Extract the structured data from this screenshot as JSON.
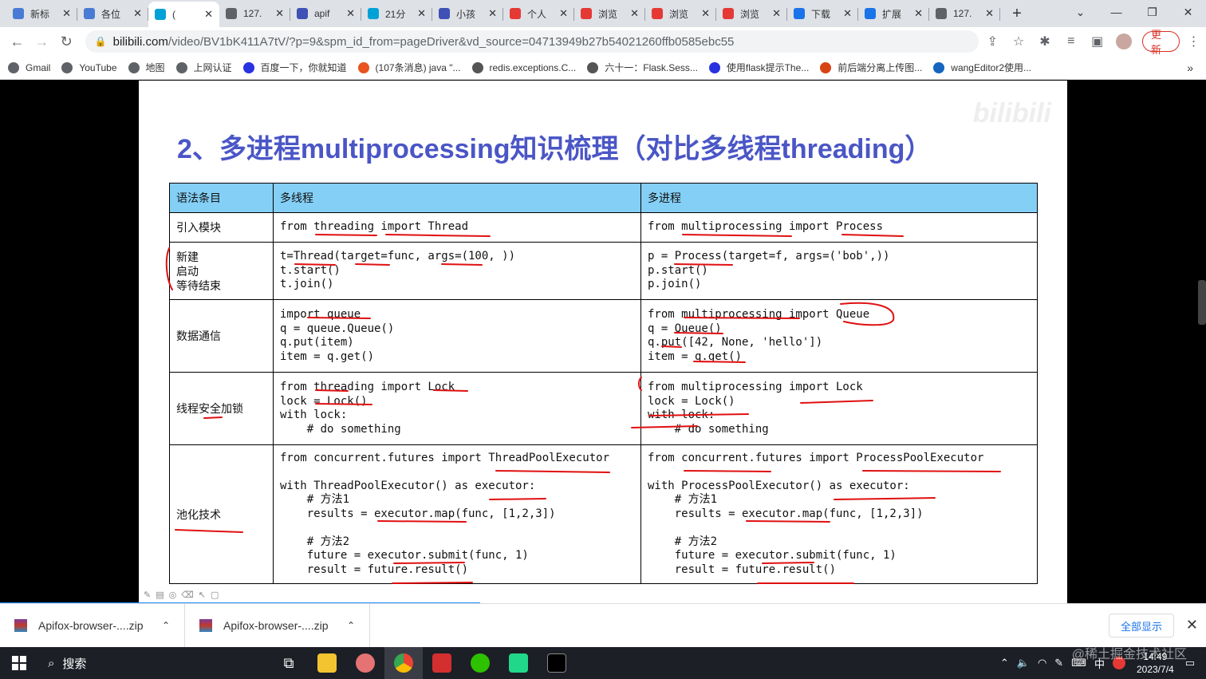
{
  "browser": {
    "tabs": [
      {
        "title": "新标",
        "color": "#4a7bd4",
        "active": false
      },
      {
        "title": "各位",
        "color": "#4a7bd4",
        "active": false
      },
      {
        "title": "(",
        "color": "#00a1d6",
        "active": true
      },
      {
        "title": "127.",
        "color": "#5f6368",
        "active": false
      },
      {
        "title": "apif",
        "color": "#3f51b5",
        "active": false
      },
      {
        "title": "21分",
        "color": "#00a1d6",
        "active": false
      },
      {
        "title": "小孩",
        "color": "#3f51b5",
        "active": false
      },
      {
        "title": "个人",
        "color": "#e53935",
        "active": false
      },
      {
        "title": "浏览",
        "color": "#e53935",
        "active": false
      },
      {
        "title": "浏览",
        "color": "#e53935",
        "active": false
      },
      {
        "title": "浏览",
        "color": "#e53935",
        "active": false
      },
      {
        "title": "下载",
        "color": "#1a73e8",
        "active": false
      },
      {
        "title": "扩展",
        "color": "#1a73e8",
        "active": false
      },
      {
        "title": "127.",
        "color": "#5f6368",
        "active": false
      }
    ],
    "url_host": "bilibili.com",
    "url_path": "/video/BV1bK411A7tV/?p=9&spm_id_from=pageDriver&vd_source=04713949b27b54021260ffb0585ebc55",
    "update_label": "更新",
    "bookmarks": [
      {
        "label": "Gmail",
        "color": "#5f6368"
      },
      {
        "label": "YouTube",
        "color": "#5f6368"
      },
      {
        "label": "地图",
        "color": "#5f6368"
      },
      {
        "label": "上网认证",
        "color": "#5f6368"
      },
      {
        "label": "百度一下，你就知道",
        "color": "#2932e1"
      },
      {
        "label": "(107条消息) java \"...",
        "color": "#e8531e"
      },
      {
        "label": "redis.exceptions.C...",
        "color": "#555555"
      },
      {
        "label": "六十一：Flask.Sess...",
        "color": "#555555"
      },
      {
        "label": "使用flask提示The...",
        "color": "#2932e1"
      },
      {
        "label": "前后端分离上传图...",
        "color": "#d84315"
      },
      {
        "label": "wangEditor2使用...",
        "color": "#1565c0"
      }
    ],
    "more_bookmarks": "»"
  },
  "slide": {
    "title": "2、多进程multiprocessing知识梳理（对比多线程threading）",
    "watermark": "bilibili",
    "headers": [
      "语法条目",
      "多线程",
      "多进程"
    ],
    "rows": [
      {
        "item": "引入模块",
        "thread": "from threading import Thread",
        "process": "from multiprocessing import Process"
      },
      {
        "item": "新建\n启动\n等待结束",
        "thread": "t=Thread(target=func, args=(100, ))\nt.start()\nt.join()",
        "process": "p = Process(target=f, args=('bob',))\np.start()\np.join()"
      },
      {
        "item": "数据通信",
        "thread": "import queue\nq = queue.Queue()\nq.put(item)\nitem = q.get()",
        "process": "from multiprocessing import Queue\nq = Queue()\nq.put([42, None, 'hello'])\nitem = q.get()"
      },
      {
        "item": "线程安全加锁",
        "thread": "from threading import Lock\nlock = Lock()\nwith lock:\n    # do something",
        "process": "from multiprocessing import Lock\nlock = Lock()\nwith lock:\n    # do something"
      },
      {
        "item": "池化技术",
        "thread": "from concurrent.futures import ThreadPoolExecutor\n\nwith ThreadPoolExecutor() as executor:\n    # 方法1\n    results = executor.map(func, [1,2,3])\n\n    # 方法2\n    future = executor.submit(func, 1)\n    result = future.result()",
        "process": "from concurrent.futures import ProcessPoolExecutor\n\nwith ProcessPoolExecutor() as executor:\n    # 方法1\n    results = executor.map(func, [1,2,3])\n\n    # 方法2\n    future = executor.submit(func, 1)\n    result = future.result()"
      }
    ]
  },
  "downloads": {
    "items": [
      "Apifox-browser-....zip",
      "Apifox-browser-....zip"
    ],
    "show_all": "全部显示"
  },
  "taskbar": {
    "search_label": "搜索",
    "time": "14:49",
    "date": "2023/7/4",
    "ime": "中"
  },
  "watermark_corner": "@稀土掘金技术社区"
}
